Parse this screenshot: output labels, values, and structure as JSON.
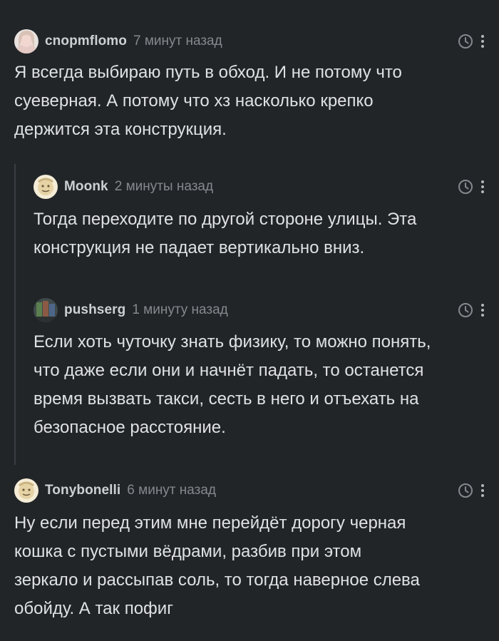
{
  "comments": [
    {
      "author": "cnopmflomo",
      "time": "7 минут назад",
      "text": "Я всегда выбираю путь в обход. И не потому что\nсуеверная. А потому что хз насколько крепко\nдержится эта конструкция."
    },
    {
      "author": "Moonk",
      "time": "2 минуты назад",
      "text": "Тогда переходите по другой стороне улицы. Эта\nконструкция не падает вертикально вниз."
    },
    {
      "author": "pushserg",
      "time": "1 минуту назад",
      "text": "Если хоть чуточку знать физику, то можно понять,\nчто даже если они и начнёт падать, то останется\nвремя вызвать такси, сесть в него и отъехать на\nбезопасное расстояние."
    },
    {
      "author": "Tonybonelli",
      "time": "6 минут назад",
      "text": "Ну если перед этим мне перейдёт дорогу черная\nкошка с пустыми вёдрами, разбив при этом\nзеркало и рассыпав соль, то тогда наверное слева\nобойду. А так пофиг"
    }
  ],
  "icons": {
    "clock": "clock-icon",
    "more": "more-vertical-icon"
  },
  "colors": {
    "background": "#222528",
    "text": "#dfe1e3",
    "muted": "#85898d",
    "thread_line": "#3a3e42"
  }
}
